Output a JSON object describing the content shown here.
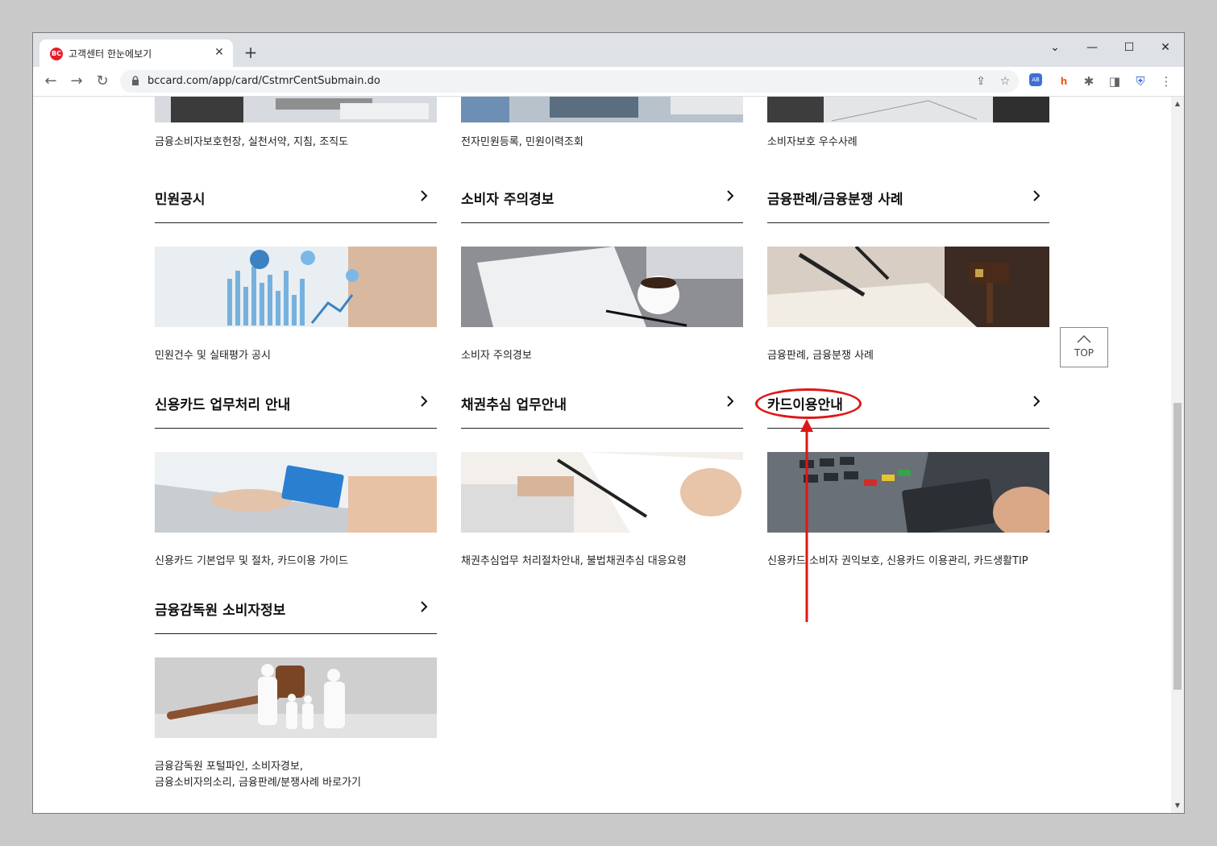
{
  "browser": {
    "tab_title": "고객센터 한눈에보기",
    "favicon_text": "BC",
    "url": "bccard.com/app/card/CstmrCentSubmain.do"
  },
  "colors": {
    "accent": "#e2202d",
    "annotation": "#e01616"
  },
  "icons": [
    "back-icon",
    "forward-icon",
    "reload-icon",
    "lock-icon",
    "share-icon",
    "star-icon",
    "extension-icon",
    "sidebar-icon",
    "shield-icon",
    "menu-icon"
  ],
  "top_descs": [
    "금융소비자보호헌장, 실천서약, 지침, 조직도",
    "전자민원등록, 민원이력조회",
    "소비자보호 우수사례"
  ],
  "cards": [
    {
      "title": "민원공시",
      "desc": "민원건수 및 실태평가 공시"
    },
    {
      "title": "소비자 주의경보",
      "desc": "소비자 주의경보"
    },
    {
      "title": "금융판례/금융분쟁 사례",
      "desc": "금융판례, 금융분쟁 사례"
    },
    {
      "title": "신용카드 업무처리 안내",
      "desc": "신용카드 기본업무 및 절차, 카드이용 가이드"
    },
    {
      "title": "채권추심 업무안내",
      "desc": "채권추심업무 처리절차안내, 불법채권추심 대응요령"
    },
    {
      "title": "카드이용안내",
      "desc": "신용카드 소비자 권익보호, 신용카드 이용관리, 카드생활TIP"
    },
    {
      "title": "금융감독원 소비자정보",
      "desc": "금융감독원 포털파인, 소비자경보,\n금융소비자의소리, 금융판례/분쟁사례 바로가기"
    }
  ],
  "top_button": {
    "label": "TOP"
  }
}
